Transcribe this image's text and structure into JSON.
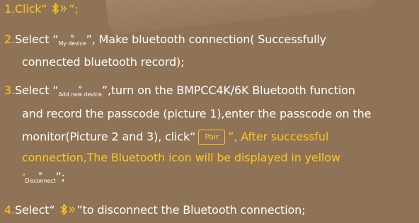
{
  "step1": {
    "num": "1.",
    "text_before": "Click“",
    "icon": "bluetooth-chevron-icon",
    "text_after": "”;"
  },
  "step2": {
    "num": "2.",
    "text_before": "Select “",
    "label": "My device",
    "text_after": "”, Make bluetooth connection( Successfully",
    "line2": "connected bluetooth record);"
  },
  "step3": {
    "num": "3.",
    "text_before": "Select “",
    "label": "Add new device",
    "text_after": "”,turn on the BMPCC4K/6K Bluetooth function",
    "line2": "and record the passcode  (picture 1),enter the passcode on the",
    "line3_pre": "monitor(Picture 2 and 3), click“",
    "pair_label": "Pair",
    "line3_post": "”, After successful",
    "line4": "connection,The Bluetooth icon will be displayed in yellow",
    "line5_open": "“",
    "disconnect_label": "Disconnect",
    "line5_close": "”;"
  },
  "step4": {
    "num": "4.",
    "text_before": "Select“",
    "text_after": "”to disconnect the Bluetooth connection;"
  },
  "colors": {
    "background": "#8e7356",
    "accent": "#ffc61f",
    "text": "#ffffff"
  }
}
